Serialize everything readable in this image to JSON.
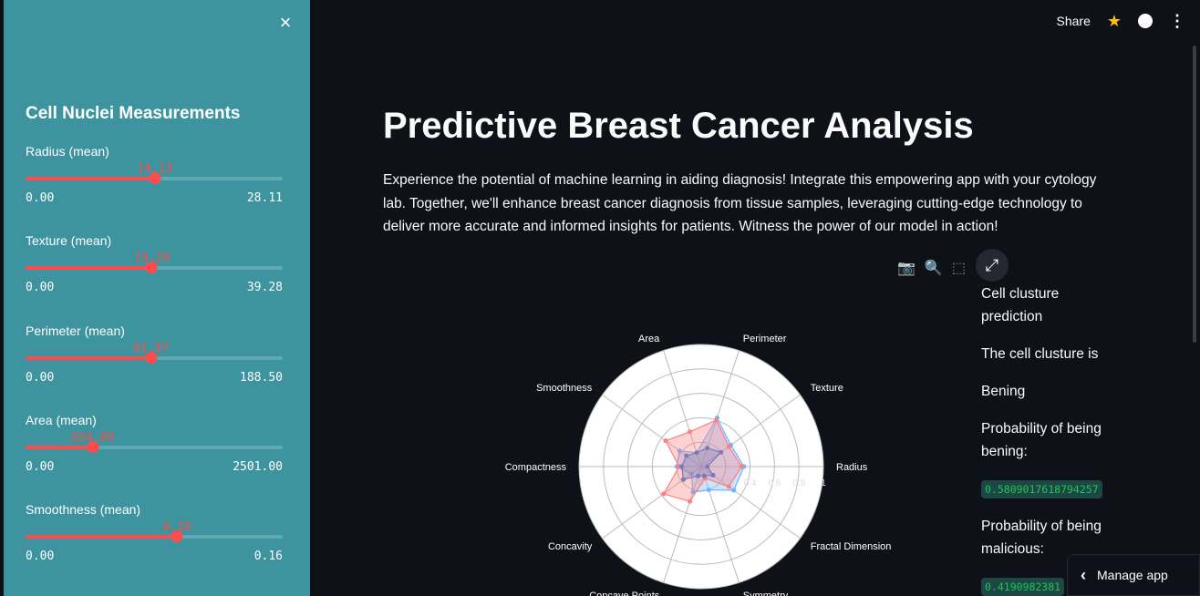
{
  "sidebar": {
    "title": "Cell Nuclei Measurements",
    "close_icon": "×",
    "sliders": [
      {
        "label": "Radius (mean)",
        "value": "14.13",
        "min": "0.00",
        "max": "28.11",
        "fraction": 0.503
      },
      {
        "label": "Texture (mean)",
        "value": "19.29",
        "min": "0.00",
        "max": "39.28",
        "fraction": 0.491
      },
      {
        "label": "Perimeter (mean)",
        "value": "91.97",
        "min": "0.00",
        "max": "188.50",
        "fraction": 0.488
      },
      {
        "label": "Area (mean)",
        "value": "654.89",
        "min": "0.00",
        "max": "2501.00",
        "fraction": 0.262
      },
      {
        "label": "Smoothness (mean)",
        "value": "0.10",
        "min": "0.00",
        "max": "0.16",
        "fraction": 0.589
      }
    ],
    "accent": "#ff4b4b",
    "bg": "#3d949e"
  },
  "topbar": {
    "share": "Share",
    "star_icon": "★",
    "github_icon": "github",
    "menu_icon": "⋮"
  },
  "main": {
    "title": "Predictive Breast Cancer Analysis",
    "intro": "Experience the potential of machine learning in aiding diagnosis! Integrate this empowering app with your cytology lab. Together, we'll enhance breast cancer diagnosis from tissue samples, leveraging cutting-edge technology to deliver more accurate and informed insights for patients. Witness the power of our model in action!"
  },
  "prediction": {
    "heading": "Cell clusture prediction",
    "result_label": "The cell clusture is",
    "result": "Bening",
    "prob_benign_label": "Probability of being bening:",
    "prob_benign": "0.5809017618794257",
    "prob_malicious_label": "Probability of being malicious:",
    "prob_malicious": "0.4190982381"
  },
  "manage_app": "Manage app",
  "chart_data": {
    "type": "radar",
    "axes": [
      "Radius",
      "Texture",
      "Perimeter",
      "Area",
      "Smoothness",
      "Compactness",
      "Concavity",
      "Concave Points",
      "Symmetry",
      "Fractal Dimension"
    ],
    "radial_ticks": [
      "0",
      "0.2",
      "0.4",
      "0.6",
      "0.8",
      "1"
    ],
    "series": [
      {
        "color": "#6fb3ff",
        "values": [
          0.35,
          0.3,
          0.42,
          0.12,
          0.22,
          0.2,
          0.1,
          0.22,
          0.2,
          0.33
        ]
      },
      {
        "color": "#ff7f7f",
        "values": [
          0.33,
          0.28,
          0.4,
          0.3,
          0.36,
          0.18,
          0.38,
          0.3,
          0.1,
          0.28
        ]
      },
      {
        "color": "#7a7ab8",
        "values": [
          0.05,
          0.2,
          0.16,
          0.12,
          0.15,
          0.16,
          0.18,
          0.08,
          0.08,
          0.12
        ]
      }
    ]
  }
}
